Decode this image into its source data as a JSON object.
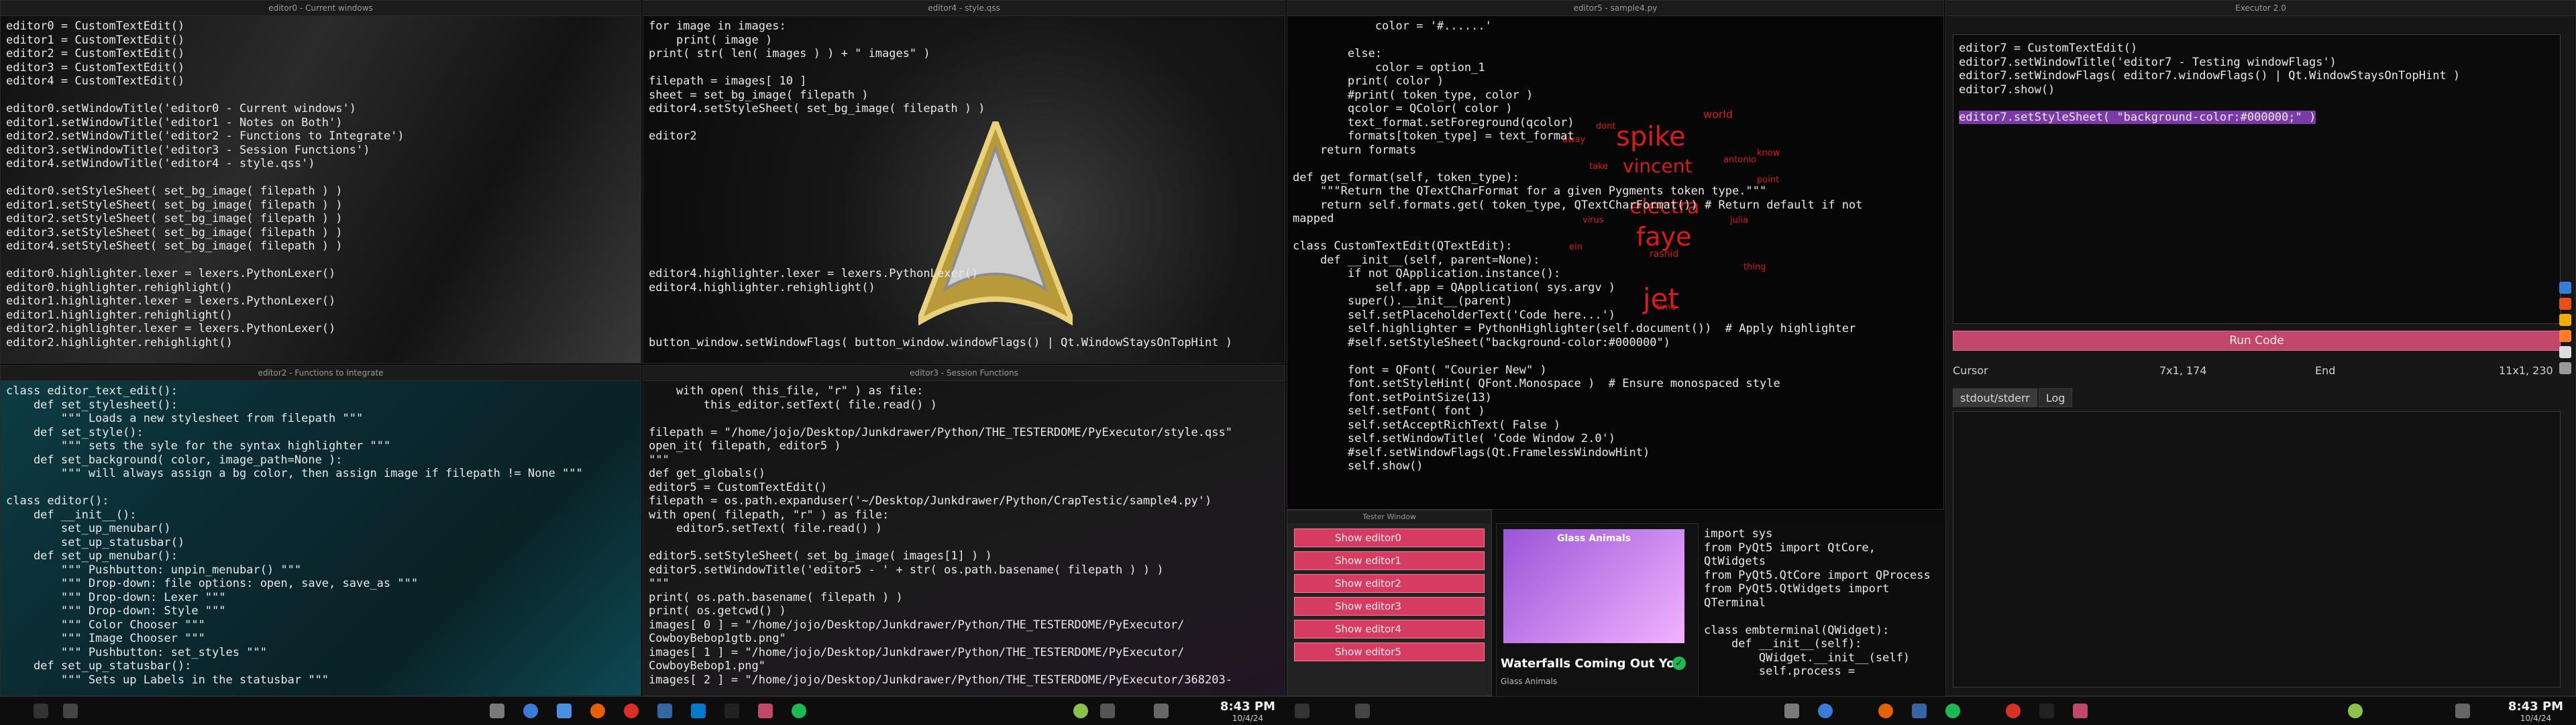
{
  "windows": {
    "editor0": {
      "title": "editor0 - Current windows",
      "lines": [
        "editor0 = CustomTextEdit()",
        "editor1 = CustomTextEdit()",
        "editor2 = CustomTextEdit()",
        "editor3 = CustomTextEdit()",
        "editor4 = CustomTextEdit()",
        "",
        "editor0.setWindowTitle('editor0 - Current windows')",
        "editor1.setWindowTitle('editor1 - Notes on Both')",
        "editor2.setWindowTitle('editor2 - Functions to Integrate')",
        "editor3.setWindowTitle('editor3 - Session Functions')",
        "editor4.setWindowTitle('editor4 - style.qss')",
        "",
        "editor0.setStyleSheet( set_bg_image( filepath ) )",
        "editor1.setStyleSheet( set_bg_image( filepath ) )",
        "editor2.setStyleSheet( set_bg_image( filepath ) )",
        "editor3.setStyleSheet( set_bg_image( filepath ) )",
        "editor4.setStyleSheet( set_bg_image( filepath ) )",
        "",
        "editor0.highlighter.lexer = lexers.PythonLexer()",
        "editor0.highlighter.rehighlight()",
        "editor1.highlighter.lexer = lexers.PythonLexer()",
        "editor1.highlighter.rehighlight()",
        "editor2.highlighter.lexer = lexers.PythonLexer()",
        "editor2.highlighter.rehighlight()"
      ]
    },
    "editor4": {
      "title": "editor4 - style.qss",
      "lines": [
        "for image in images:",
        "    print( image )",
        "print( str( len( images ) ) + \" images\" )",
        "",
        "filepath = images[ 10 ]",
        "sheet = set_bg_image( filepath )",
        "editor4.setStyleSheet( set_bg_image( filepath ) )",
        "",
        "editor2",
        "",
        "",
        "",
        "",
        "",
        "",
        "",
        "",
        "",
        "editor4.highlighter.lexer = lexers.PythonLexer()",
        "editor4.highlighter.rehighlight()",
        "",
        "",
        "",
        "button_window.setWindowFlags( button_window.windowFlags() | Qt.WindowStaysOnTopHint )"
      ]
    },
    "editor5": {
      "title": "editor5 - sample4.py",
      "lines": [
        "            color = '#......'",
        "",
        "        else:",
        "            color = option_1",
        "        print( color )",
        "        #print( token_type, color )",
        "        qcolor = QColor( color )",
        "        text_format.setForeground(qcolor)",
        "        formats[token_type] = text_format",
        "    return formats",
        "",
        "def get_format(self, token_type):",
        "    \"\"\"Return the QTextCharFormat for a given Pygments token type.\"\"\"",
        "    return self.formats.get( token_type, QTextCharFormat()) # Return default if not",
        "mapped",
        "",
        "class CustomTextEdit(QTextEdit):",
        "    def __init__(self, parent=None):",
        "        if not QApplication.instance():",
        "            self.app = QApplication( sys.argv )",
        "        super().__init__(parent)",
        "        self.setPlaceholderText('Code here...')",
        "        self.highlighter = PythonHighlighter(self.document())  # Apply highlighter",
        "        #self.setStyleSheet(\"background-color:#000000\")",
        "",
        "        font = QFont( \"Courier New\" )",
        "        font.setStyleHint( QFont.Monospace )  # Ensure monospaced style",
        "        font.setPointSize(13)",
        "        self.setFont( font )",
        "        self.setAcceptRichText( False )",
        "        self.setWindowTitle( 'Code Window 2.0')",
        "        #self.setWindowFlags(Qt.FramelessWindowHint)",
        "        self.show()"
      ]
    },
    "editor2": {
      "title": "editor2 - Functions to Integrate",
      "lines": [
        "class editor_text_edit():",
        "    def set_stylesheet():",
        "        \"\"\" Loads a new stylesheet from filepath \"\"\"",
        "    def set_style():",
        "        \"\"\" sets the syle for the syntax highlighter \"\"\"",
        "    def set_background( color, image_path=None ):",
        "        \"\"\" will always assign a bg color, then assign image if filepath != None \"\"\"",
        "",
        "class editor():",
        "    def __init__():",
        "        set_up_menubar()",
        "        set_up_statusbar()",
        "    def set_up_menubar():",
        "        \"\"\" Pushbutton: unpin_menubar() \"\"\"",
        "        \"\"\" Drop-down: file options: open, save, save_as \"\"\"",
        "        \"\"\" Drop-down: Lexer \"\"\"",
        "        \"\"\" Drop-down: Style \"\"\"",
        "        \"\"\" Color Chooser \"\"\"",
        "        \"\"\" Image Chooser \"\"\"",
        "        \"\"\" Pushbutton: set_styles \"\"\"",
        "    def set_up_statusbar():",
        "        \"\"\" Sets up Labels in the statusbar \"\"\""
      ]
    },
    "editor3": {
      "title": "editor3 - Session Functions",
      "lines": [
        "    with open( this_file, \"r\" ) as file:",
        "        this_editor.setText( file.read() )",
        "",
        "filepath = \"/home/jojo/Desktop/Junkdrawer/Python/THE_TESTERDOME/PyExecutor/style.qss\"",
        "open_it( filepath, editor5 )",
        "\"\"\"",
        "def get_globals()",
        "editor5 = CustomTextEdit()",
        "filepath = os.path.expanduser('~/Desktop/Junkdrawer/Python/CrapTestic/sample4.py')",
        "with open( filepath, \"r\" ) as file:",
        "    editor5.setText( file.read() )",
        "",
        "editor5.setStyleSheet( set_bg_image( images[1] ) )",
        "editor5.setWindowTitle('editor5 - ' + str( os.path.basename( filepath ) ) )",
        "\"\"\"",
        "print( os.path.basename( filepath ) )",
        "print( os.getcwd() )",
        "images[ 0 ] = \"/home/jojo/Desktop/Junkdrawer/Python/THE_TESTERDOME/PyExecutor/",
        "CowboyBebop1gtb.png\"",
        "images[ 1 ] = \"/home/jojo/Desktop/Junkdrawer/Python/THE_TESTERDOME/PyExecutor/",
        "CowboyBebop1.png\"",
        "images[ 2 ] = \"/home/jojo/Desktop/Junkdrawer/Python/THE_TESTERDOME/PyExecutor/368203-"
      ]
    },
    "executor": {
      "title": "Executor 2.0",
      "lines": [
        "editor7 = CustomTextEdit()",
        "editor7.setWindowTitle('editor7 - Testing windowFlags')",
        "editor7.setWindowFlags( editor7.windowFlags() | Qt.WindowStaysOnTopHint )",
        "editor7.show()",
        "",
        "editor7.setStyleSheet( \"background-color:#000000;\" )"
      ],
      "run_label": "Run Code",
      "cursor_label": "Cursor",
      "cursor_pos": "7x1, 174",
      "end_label": "End",
      "end_pos": "11x1, 230",
      "tab_stdout": "stdout/stderr",
      "tab_log": "Log"
    },
    "tester": {
      "title": "Tester Window",
      "buttons": [
        "Show editor0",
        "Show editor1",
        "Show editor2",
        "Show editor3",
        "Show editor4",
        "Show editor5"
      ]
    },
    "editor6": {
      "lines": [
        "import sys",
        "from PyQt5 import QtCore,",
        "QtWidgets",
        "from PyQt5.QtCore import QProcess",
        "from PyQt5.QtWidgets import",
        "QTerminal",
        "",
        "class embterminal(QWidget):",
        "    def __init__(self):",
        "        QWidget.__init__(self)",
        "        self.process ="
      ]
    }
  },
  "media": {
    "album_text": "Glass Animals",
    "song_title": "Waterfalls Coming Out Yo",
    "artist": "Glass Animals"
  },
  "wordcloud": [
    "spike",
    "vincent",
    "electra",
    "faye",
    "jet",
    "world",
    "antonio",
    "rashid",
    "thing",
    "virus",
    "take",
    "away",
    "know",
    "point",
    "time",
    "julia",
    "ein",
    "dont"
  ],
  "taskbar": {
    "clock_left_time": "8:43 PM",
    "clock_left_date": "10/4/24",
    "clock_right_time": "8:43 PM",
    "clock_right_date": "10/4/24"
  },
  "colors": {
    "accent": "#c1476d",
    "keyword": "#ff5e5e",
    "string": "#ffb000",
    "wordcloud": "#d81b1b"
  }
}
